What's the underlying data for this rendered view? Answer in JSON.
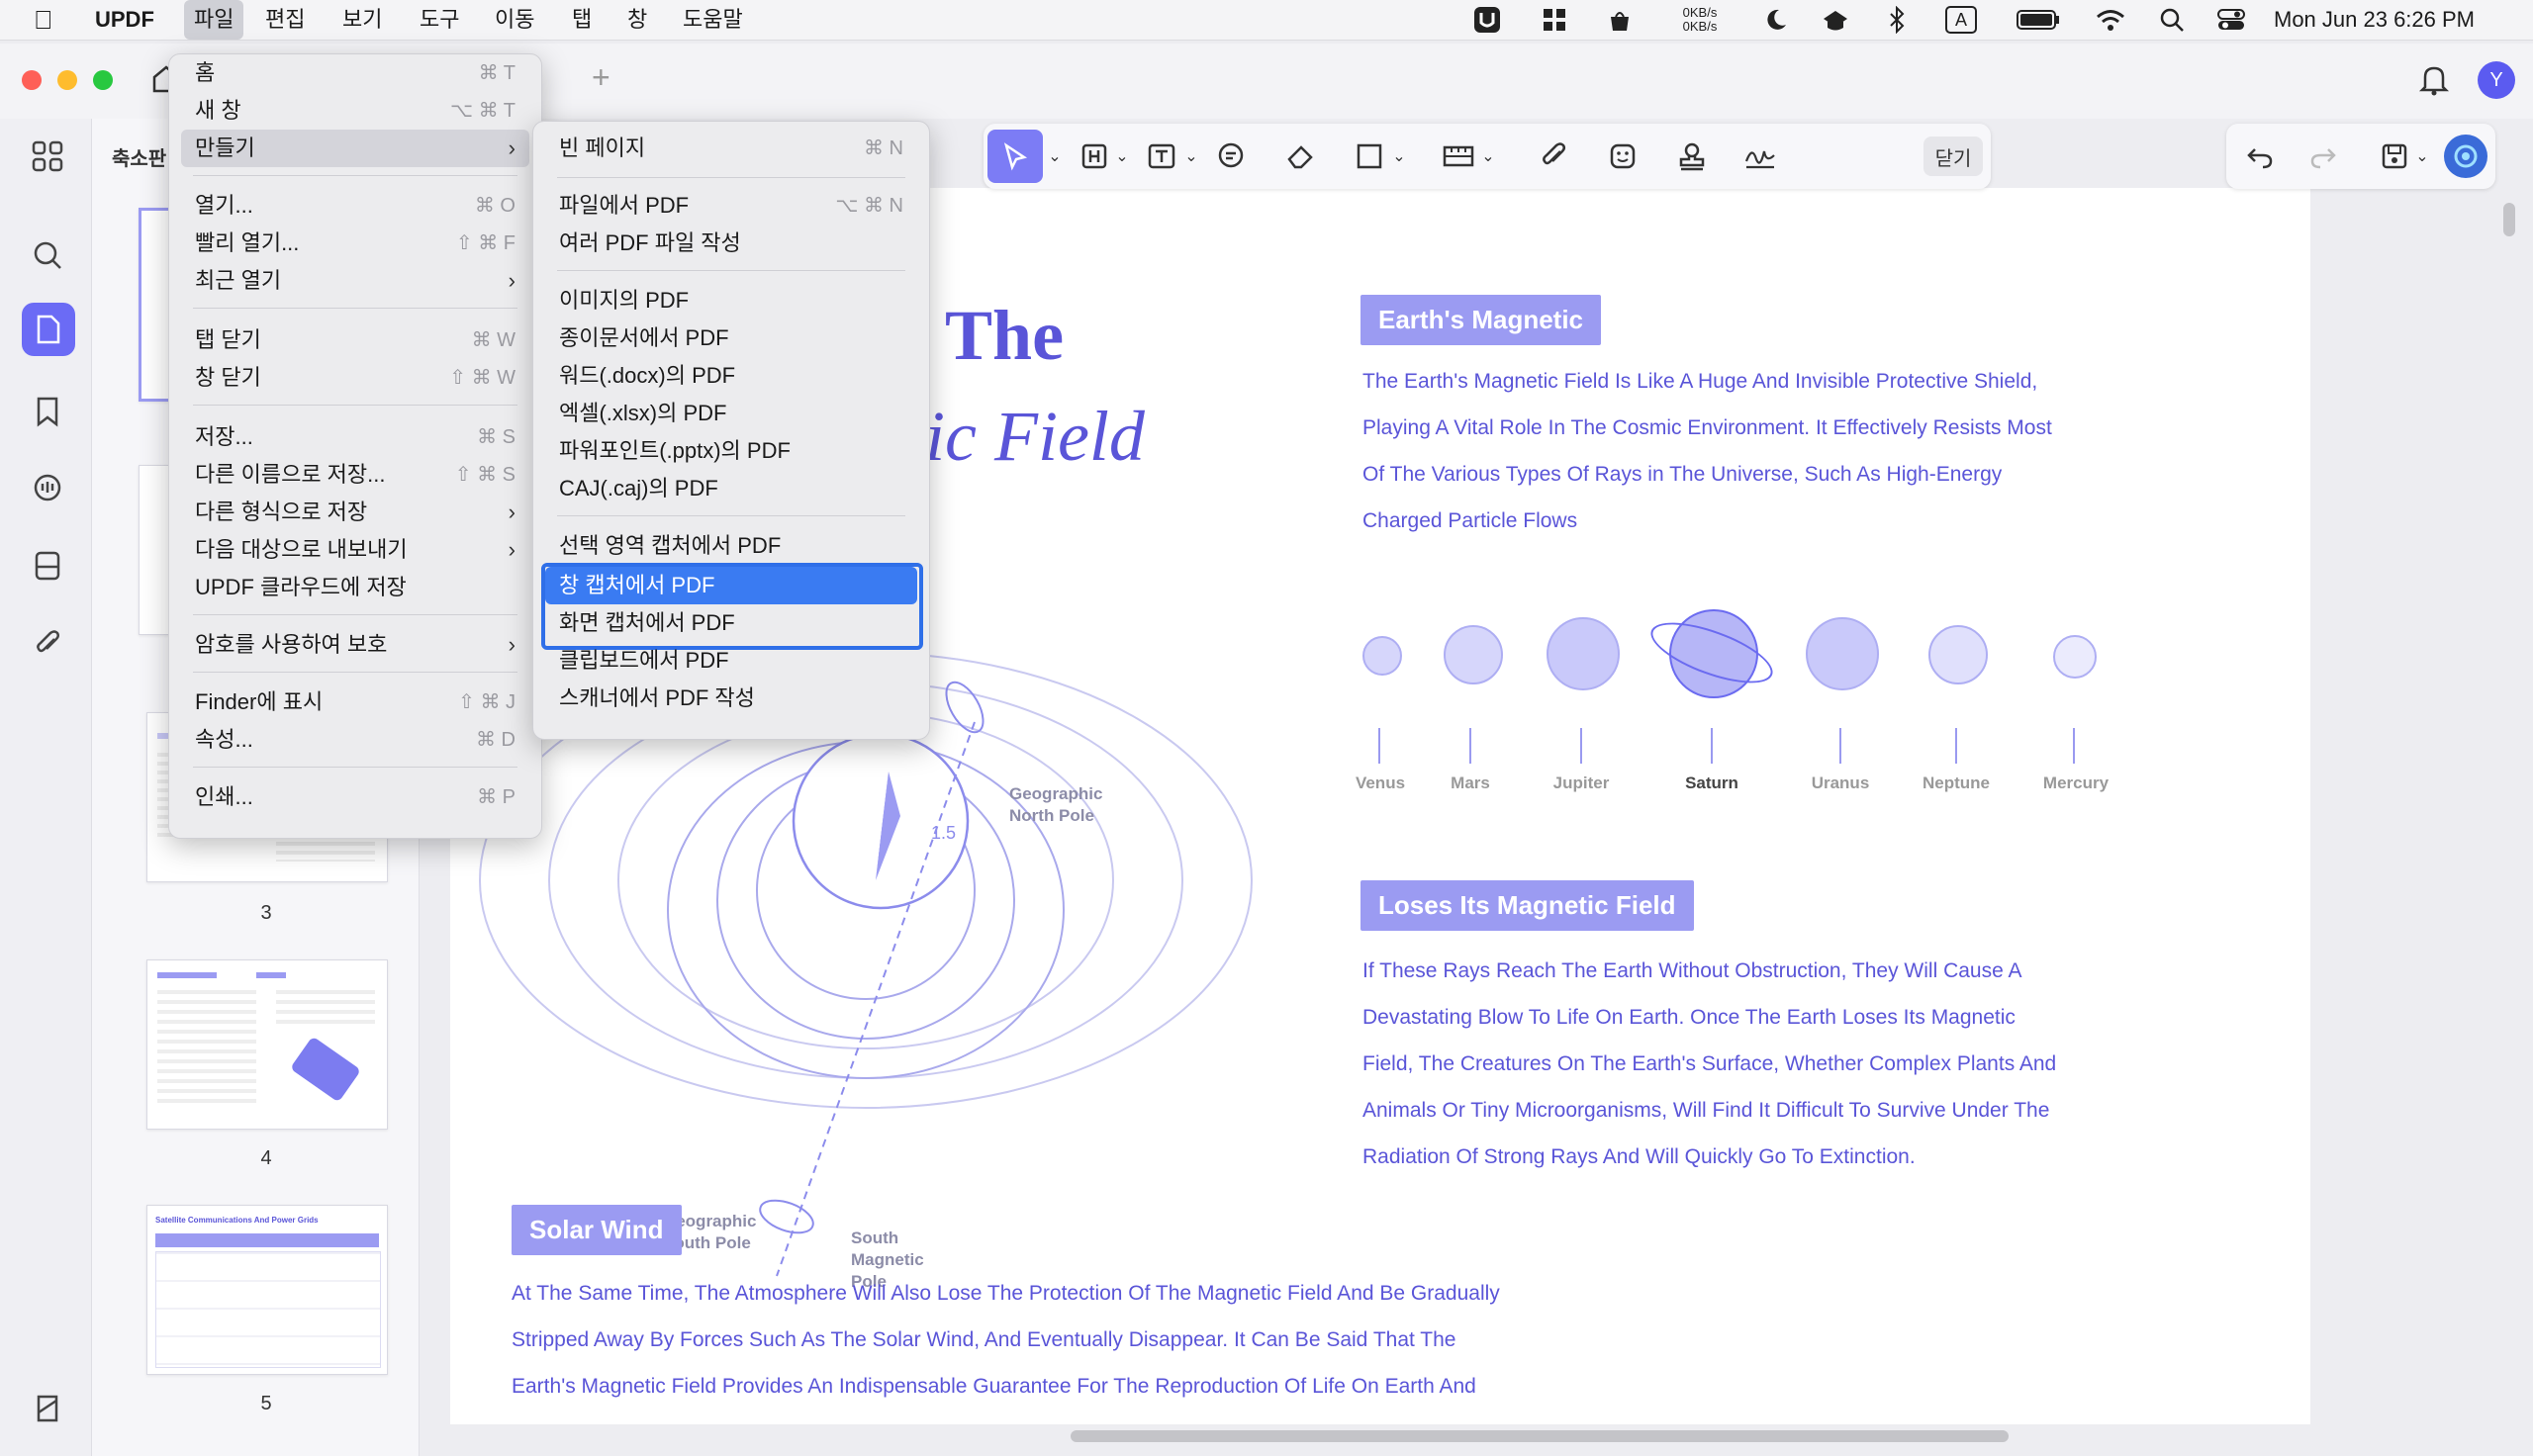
{
  "menubar": {
    "app": "UPDF",
    "items": [
      "파일",
      "편집",
      "보기",
      "도구",
      "이동",
      "탭",
      "창",
      "도움말"
    ],
    "net_up": "0KB/s",
    "net_down": "0KB/s",
    "input_badge": "A",
    "datetime": "Mon Jun 23  6:26 PM"
  },
  "window": {
    "panel_title": "축소판",
    "avatar_letter": "Y",
    "close_label": "닫기"
  },
  "thumbnails": {
    "pages": [
      "3",
      "4",
      "5"
    ],
    "page5_title": "Satellite Communications And Power Grids"
  },
  "document": {
    "title_line1": "The",
    "title_line2": "ic Field",
    "section1_title": "Earth's Magnetic",
    "section1_body": [
      "The Earth's Magnetic Field Is Like A Huge And Invisible Protective Shield,",
      "Playing A Vital Role In The Cosmic Environment. It Effectively Resists Most",
      "Of The Various Types Of Rays in The Universe, Such As High-Energy",
      "Charged Particle Flows"
    ],
    "planets": [
      "Venus",
      "Mars",
      "Jupiter",
      "Saturn",
      "Uranus",
      "Neptune",
      "Mercury"
    ],
    "section2_title": "Loses Its Magnetic Field",
    "section2_body": [
      "If These Rays Reach The Earth Without Obstruction, They Will Cause A",
      "Devastating Blow To Life On Earth. Once The Earth Loses Its Magnetic",
      "Field, The Creatures On The Earth's Surface, Whether Complex Plants And",
      "Animals Or Tiny Microorganisms, Will Find It Difficult To Survive Under The",
      "Radiation Of Strong Rays And Will Quickly Go To Extinction."
    ],
    "section3_title": "Solar Wind",
    "section3_body": [
      "At The Same Time, The Atmosphere Will Also Lose The Protection Of The Magnetic Field And Be Gradually",
      "Stripped Away By Forces Such As The Solar Wind, And Eventually Disappear. It Can Be Said That The",
      "Earth's Magnetic Field Provides An Indispensable Guarantee For The Reproduction Of Life On Earth And"
    ],
    "diagram_labels": {
      "north": [
        "Geographic",
        "North Pole"
      ],
      "south_geo": [
        "Geographic",
        "South Pole"
      ],
      "south_mag": [
        "South",
        "Magnetic",
        "Pole"
      ],
      "angle": "1.5"
    }
  },
  "file_menu": {
    "items": [
      {
        "label": "홈",
        "shortcut": "⌘ T"
      },
      {
        "label": "새 창",
        "shortcut": "⌥ ⌘ T"
      },
      {
        "label": "만들기",
        "shortcut": "›"
      },
      {
        "label": "열기...",
        "shortcut": "⌘ O"
      },
      {
        "label": "빨리 열기...",
        "shortcut": "⇧ ⌘ F"
      },
      {
        "label": "최근 열기",
        "shortcut": "›"
      },
      {
        "label": "탭 닫기",
        "shortcut": "⌘ W"
      },
      {
        "label": "창 닫기",
        "shortcut": "⇧ ⌘ W"
      },
      {
        "label": "저장...",
        "shortcut": "⌘ S"
      },
      {
        "label": "다른 이름으로 저장...",
        "shortcut": "⇧ ⌘ S"
      },
      {
        "label": "다른 형식으로 저장",
        "shortcut": "›"
      },
      {
        "label": "다음 대상으로 내보내기",
        "shortcut": "›"
      },
      {
        "label": "UPDF 클라우드에 저장",
        "shortcut": ""
      },
      {
        "label": "암호를 사용하여 보호",
        "shortcut": "›"
      },
      {
        "label": "Finder에 표시",
        "shortcut": "⇧ ⌘ J"
      },
      {
        "label": "속성...",
        "shortcut": "⌘ D"
      },
      {
        "label": "인쇄...",
        "shortcut": "⌘ P"
      }
    ]
  },
  "create_menu": {
    "items": [
      {
        "label": "빈 페이지",
        "shortcut": "⌘ N"
      },
      {
        "label": "파일에서 PDF",
        "shortcut": "⌥ ⌘ N"
      },
      {
        "label": "여러 PDF 파일 작성",
        "shortcut": ""
      },
      {
        "label": "이미지의 PDF",
        "shortcut": ""
      },
      {
        "label": "종이문서에서 PDF",
        "shortcut": ""
      },
      {
        "label": "워드(.docx)의 PDF",
        "shortcut": ""
      },
      {
        "label": "엑셀(.xlsx)의 PDF",
        "shortcut": ""
      },
      {
        "label": "파워포인트(.pptx)의 PDF",
        "shortcut": ""
      },
      {
        "label": "CAJ(.caj)의 PDF",
        "shortcut": ""
      },
      {
        "label": "선택 영역 캡처에서 PDF",
        "shortcut": ""
      },
      {
        "label": "창 캡처에서 PDF",
        "shortcut": ""
      },
      {
        "label": "화면 캡처에서 PDF",
        "shortcut": ""
      },
      {
        "label": "클립보드에서 PDF",
        "shortcut": ""
      },
      {
        "label": "스캐너에서 PDF 작성",
        "shortcut": ""
      }
    ]
  }
}
